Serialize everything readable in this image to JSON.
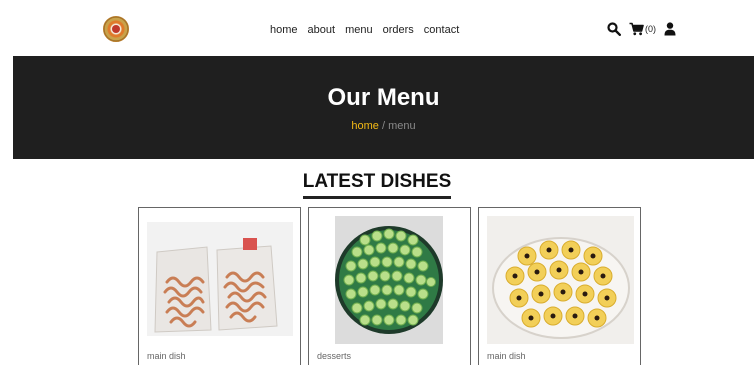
{
  "nav": {
    "links": [
      {
        "label": "home"
      },
      {
        "label": "about"
      },
      {
        "label": "menu"
      },
      {
        "label": "orders"
      },
      {
        "label": "contact"
      }
    ],
    "cart_count": "(0)"
  },
  "hero": {
    "title": "Our Menu",
    "breadcrumb_home": "home",
    "breadcrumb_sep": " / ",
    "breadcrumb_current": "menu"
  },
  "section": {
    "title": "LATEST DISHES"
  },
  "cards": [
    {
      "category": "main dish"
    },
    {
      "category": "desserts"
    },
    {
      "category": "main dish"
    }
  ],
  "colors": {
    "hero_bg": "#1f1f1f",
    "accent": "#f3b915"
  },
  "icons": [
    "logo-icon",
    "search-icon",
    "cart-icon",
    "user-icon"
  ]
}
